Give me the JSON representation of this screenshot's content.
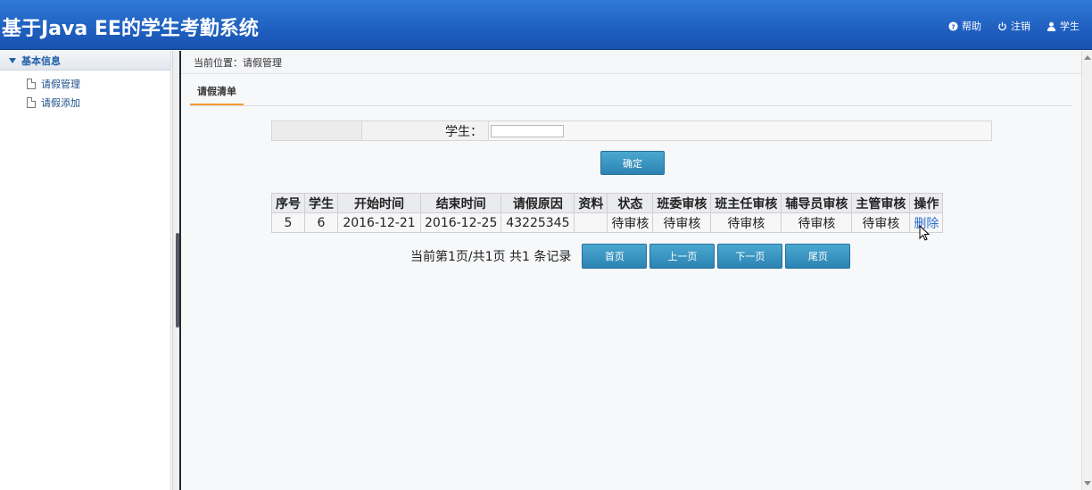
{
  "header": {
    "title": "基于Java EE的学生考勤系统",
    "tools": [
      {
        "icon": "help-icon",
        "label": "帮助"
      },
      {
        "icon": "power-icon",
        "label": "注销"
      },
      {
        "icon": "user-icon",
        "label": "学生"
      }
    ]
  },
  "sidebar": {
    "group": "基本信息",
    "items": [
      {
        "label": "请假管理"
      },
      {
        "label": "请假添加"
      }
    ]
  },
  "main": {
    "breadcrumb": "当前位置：请假管理",
    "tab": "请假清单",
    "search": {
      "label": "学生：",
      "value": ""
    },
    "confirm_label": "确定",
    "table": {
      "headers": [
        "序号",
        "学生",
        "开始时间",
        "结束时间",
        "请假原因",
        "资料",
        "状态",
        "班委审核",
        "班主任审核",
        "辅导员审核",
        "主管审核",
        "操作"
      ],
      "rows": [
        [
          "5",
          "6",
          "2016-12-21",
          "2016-12-25",
          "43225345",
          "",
          "待审核",
          "待审核",
          "待审核",
          "待审核",
          "待审核",
          "删除"
        ]
      ]
    },
    "pager": {
      "info": "当前第1页/共1页  共1 条记录",
      "first": "首页",
      "prev": "上一页",
      "next": "下一页",
      "last": "尾页"
    }
  },
  "colors": {
    "header": "#1f5fc0",
    "button": "#2c83b3",
    "tab_underline": "#f29a2e",
    "link": "#2a6fd0"
  }
}
